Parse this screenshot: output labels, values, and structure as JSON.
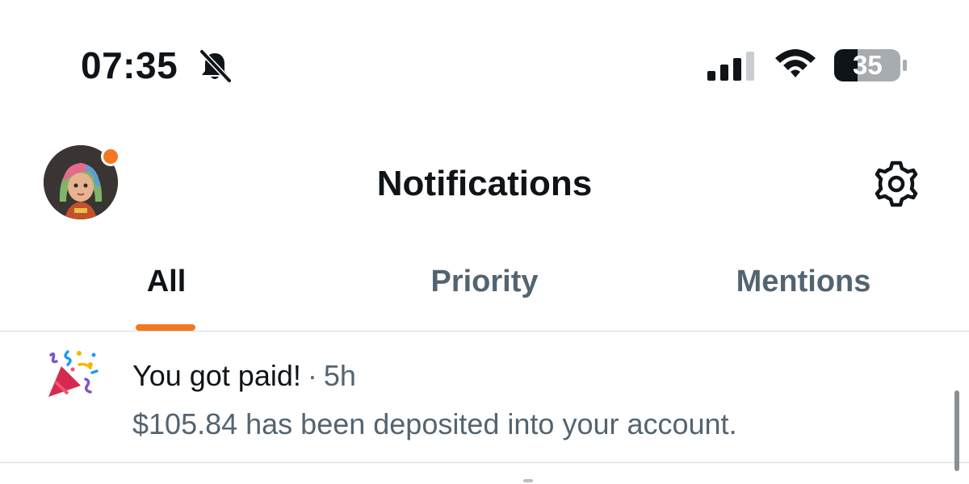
{
  "status_bar": {
    "time": "07:35",
    "battery_percent": "35",
    "icons": [
      "bell-slash-icon",
      "cellular-signal-icon",
      "wifi-icon",
      "battery-icon"
    ]
  },
  "header": {
    "title": "Notifications",
    "avatar_icon": "avatar",
    "settings_icon": "gear-icon"
  },
  "tabs": {
    "active": "All",
    "items": [
      {
        "label": "All"
      },
      {
        "label": "Priority"
      },
      {
        "label": "Mentions"
      }
    ]
  },
  "notifications": [
    {
      "icon": "party-popper-icon",
      "title": "You got paid!",
      "separator": "·",
      "time_ago": "5h",
      "body": "$105.84 has been deposited into your account."
    }
  ],
  "colors": {
    "accent": "#f3781f",
    "text_primary": "#0f1419",
    "text_secondary": "#536471",
    "divider": "#d7dbdf"
  }
}
